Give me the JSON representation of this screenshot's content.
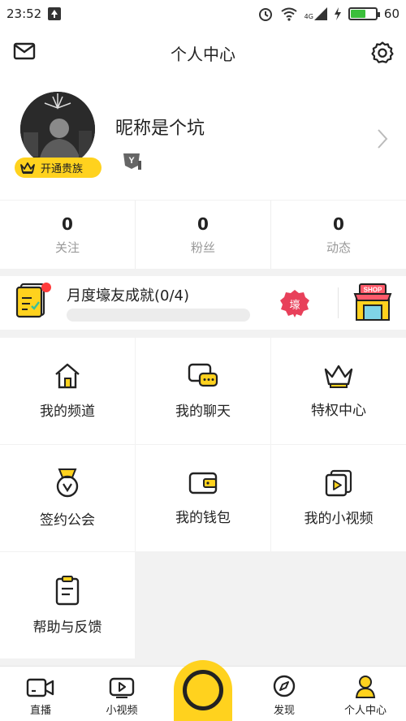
{
  "status_bar": {
    "time": "23:52",
    "network": "4G",
    "battery": "60",
    "battery_level": 0.6
  },
  "header": {
    "title": "个人中心",
    "left_icon": "mail-icon",
    "right_icon": "gear-icon"
  },
  "profile": {
    "nickname": "昵称是个坑",
    "vip_label": "开通贵族",
    "level_badge": "Y"
  },
  "stats": [
    {
      "value": "0",
      "label": "关注"
    },
    {
      "value": "0",
      "label": "粉丝"
    },
    {
      "value": "0",
      "label": "动态"
    }
  ],
  "achievement": {
    "title": "月度壕友成就(0/4)",
    "progress": 0,
    "badge_text": "壕",
    "shop_text": "SHOP"
  },
  "menu": [
    {
      "label": "我的频道",
      "icon": "house-icon"
    },
    {
      "label": "我的聊天",
      "icon": "chat-icon"
    },
    {
      "label": "特权中心",
      "icon": "crown-icon"
    },
    {
      "label": "签约公会",
      "icon": "medal-icon"
    },
    {
      "label": "我的钱包",
      "icon": "wallet-icon"
    },
    {
      "label": "我的小视频",
      "icon": "video-file-icon"
    },
    {
      "label": "帮助与反馈",
      "icon": "clipboard-icon"
    }
  ],
  "tabbar": {
    "tabs": [
      {
        "label": "直播",
        "icon": "camera-icon"
      },
      {
        "label": "小视频",
        "icon": "play-icon"
      },
      {
        "label": "发现",
        "icon": "compass-icon"
      },
      {
        "label": "个人中心",
        "icon": "person-icon"
      }
    ],
    "accent": "#ffd21e"
  }
}
